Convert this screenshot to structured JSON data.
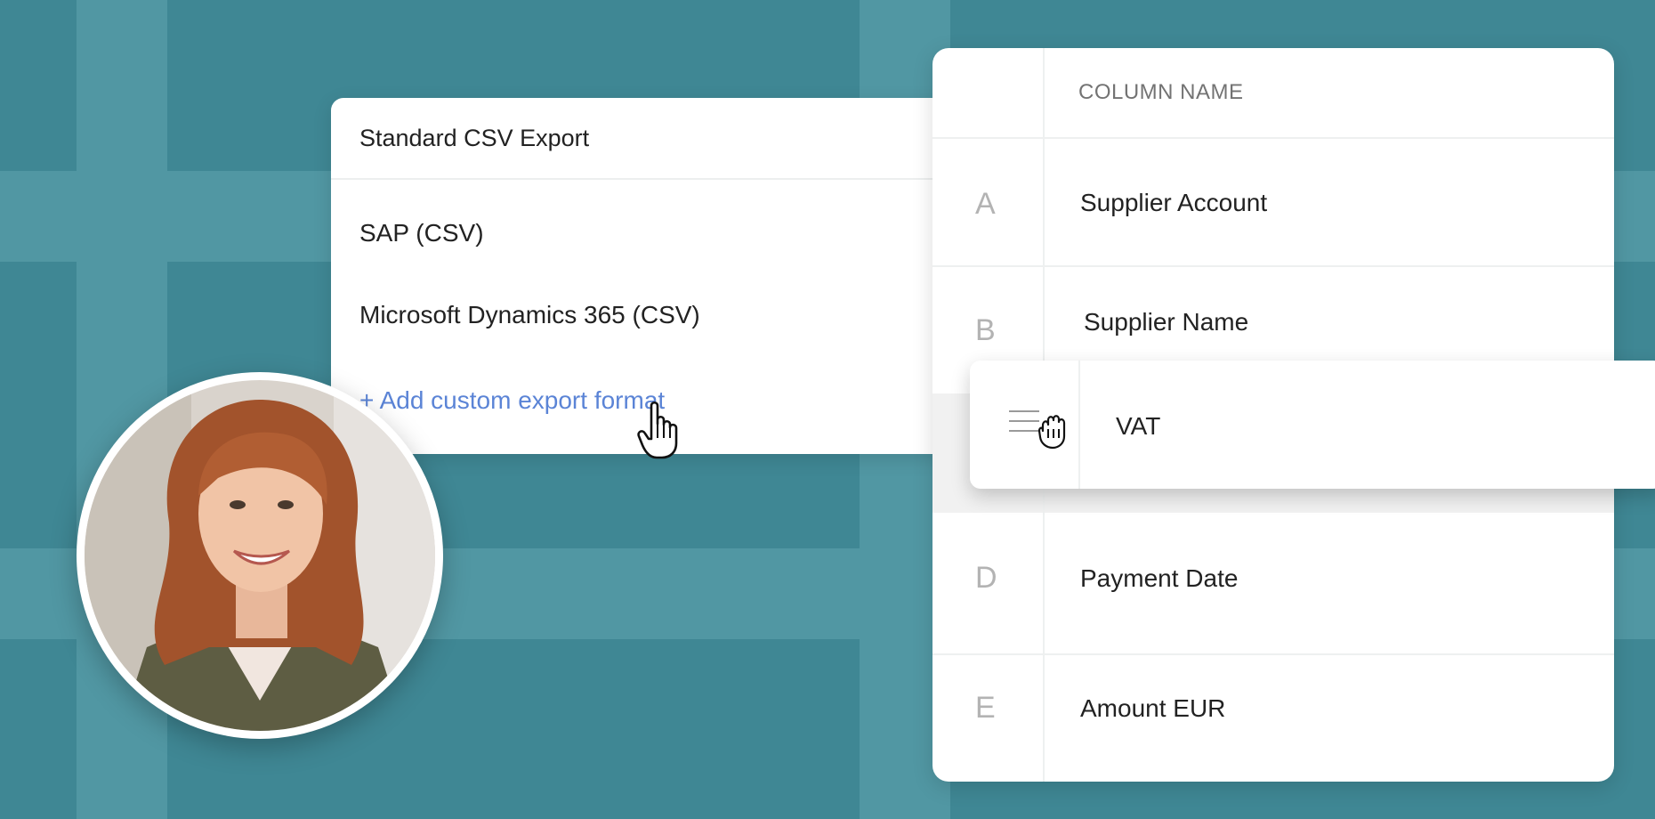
{
  "export_dropdown": {
    "selected": "Standard CSV Export",
    "options": [
      "SAP (CSV)",
      "Microsoft Dynamics 365 (CSV)"
    ],
    "add_custom": "+ Add custom export format"
  },
  "column_table": {
    "header": "COLUMN NAME",
    "rows": [
      {
        "letter": "A",
        "name": "Supplier Account"
      },
      {
        "letter": "B",
        "name": "Supplier Name"
      },
      {
        "letter": "D",
        "name": "Payment Date"
      },
      {
        "letter": "E",
        "name": "Amount EUR"
      }
    ],
    "dragged_row": {
      "name": "VAT"
    }
  },
  "icons": [
    "hand-pointer-cursor-icon",
    "grab-cursor-icon",
    "drag-handle-icon"
  ],
  "colors": {
    "background": "#3f8794",
    "link": "#5b84d6"
  }
}
